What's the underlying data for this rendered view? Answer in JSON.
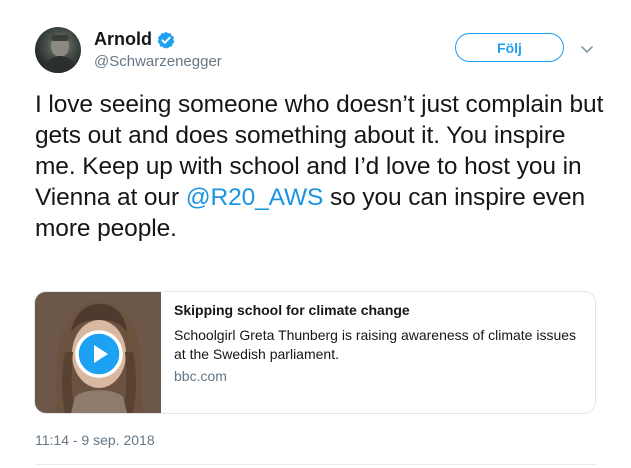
{
  "author": {
    "display_name": "Arnold",
    "handle": "@Schwarzenegger",
    "verified_icon": "verified-badge-icon",
    "avatar_icon": "avatar-photo"
  },
  "follow_button": {
    "label": "Följ"
  },
  "menu": {
    "icon": "chevron-down-icon"
  },
  "tweet": {
    "text_before": "I love seeing someone who doesn’t just complain but gets out and does something about it. You inspire me. Keep up with school and I’d love to host you in Vienna at our ",
    "mention": "@R20_AWS",
    "text_after": " so you can inspire even more people.",
    "timestamp": "11:14 - 9 sep. 2018"
  },
  "card": {
    "title": "Skipping school for climate change",
    "description": "Schoolgirl Greta Thunberg is raising awareness of climate issues at the Swedish parliament.",
    "domain": "bbc.com",
    "play_icon": "play-icon"
  },
  "colors": {
    "accent": "#1da1f2",
    "mention": "#1b95e0",
    "secondary_text": "#657786",
    "border": "#e1e8ed"
  }
}
